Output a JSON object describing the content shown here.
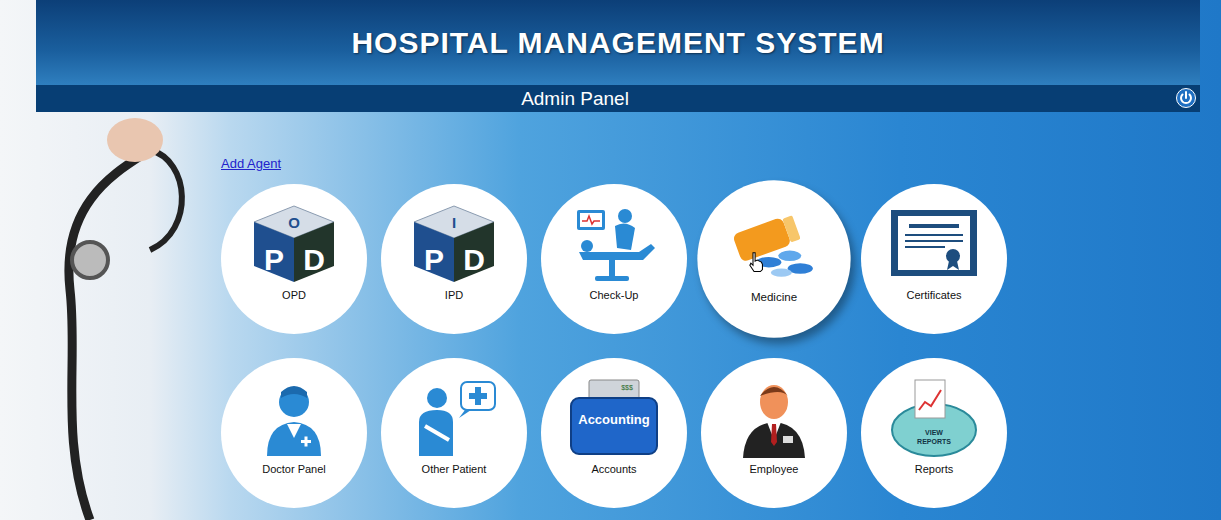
{
  "header": {
    "title": "HOSPITAL MANAGEMENT SYSTEM",
    "subtitle": "Admin Panel"
  },
  "add_agent": "Add Agent",
  "tiles": [
    {
      "label": "OPD",
      "kind": "cube",
      "icon_text": [
        "O",
        "P",
        "D"
      ],
      "hovered": false
    },
    {
      "label": "IPD",
      "kind": "cube",
      "icon_text": [
        "I",
        "P",
        "D"
      ],
      "hovered": false
    },
    {
      "label": "Check-Up",
      "kind": "checkup",
      "icon_text": [],
      "hovered": false
    },
    {
      "label": "Medicine",
      "kind": "medicine",
      "icon_text": [],
      "hovered": true
    },
    {
      "label": "Certificates",
      "kind": "certificate",
      "icon_text": [],
      "hovered": false
    },
    {
      "label": "Doctor Panel",
      "kind": "doctor",
      "icon_text": [],
      "hovered": false
    },
    {
      "label": "Other Patient",
      "kind": "patient",
      "icon_text": [],
      "hovered": false
    },
    {
      "label": "Accounts",
      "kind": "accounting",
      "icon_text": [
        "$$$",
        "Accounting"
      ],
      "hovered": false
    },
    {
      "label": "Employee",
      "kind": "employee",
      "icon_text": [],
      "hovered": false
    },
    {
      "label": "Reports",
      "kind": "reports",
      "icon_text": [
        "VIEW",
        "REPORTS"
      ],
      "hovered": false
    }
  ]
}
